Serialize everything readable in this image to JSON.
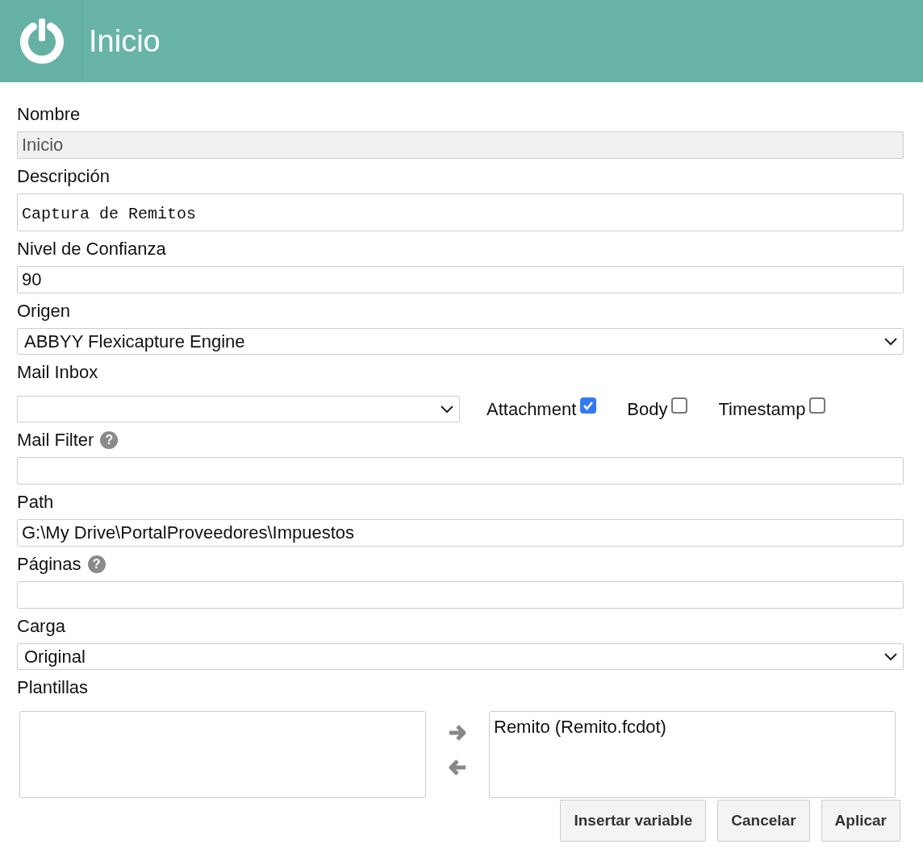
{
  "header": {
    "title": "Inicio"
  },
  "fields": [
    {
      "kind": "text",
      "label": "Nombre",
      "value": "Inicio",
      "disabled": true
    },
    {
      "kind": "mono",
      "label": "Descripción",
      "value": "Captura de Remitos"
    },
    {
      "kind": "text",
      "label": "Nivel de Confianza",
      "value": "90"
    },
    {
      "kind": "select",
      "label": "Origen",
      "value": "ABBYY Flexicapture Engine"
    },
    {
      "kind": "mail",
      "label": "Mail Inbox",
      "checks": [
        {
          "label": "Attachment",
          "checked": true
        },
        {
          "label": "Body",
          "checked": false
        },
        {
          "label": "Timestamp",
          "checked": false
        }
      ]
    },
    {
      "kind": "text",
      "label": "Mail Filter",
      "help": "?"
    },
    {
      "kind": "text",
      "label": "Path",
      "value": "G:\\My Drive\\PortalProveedores\\Impuestos"
    },
    {
      "kind": "text",
      "label": "Páginas",
      "help": "?"
    },
    {
      "kind": "select",
      "label": "Carga",
      "value": "Original"
    },
    {
      "kind": "templates",
      "label": "Plantillas",
      "selected_items": [
        "Remito (Remito.fcdot)"
      ]
    }
  ],
  "buttons": [
    "Insertar variable",
    "Cancelar",
    "Aplicar"
  ]
}
